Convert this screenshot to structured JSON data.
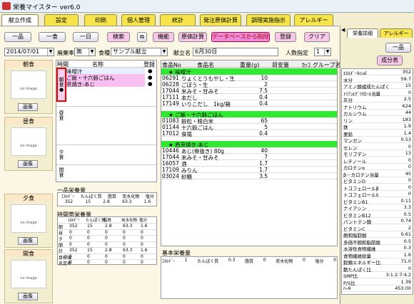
{
  "app": {
    "title": "栄養マイスター ver6.0"
  },
  "tabs": [
    "献立作成",
    "設定",
    "印刷",
    "個人管理",
    "統計",
    "発注原価計算",
    "調理実施指示",
    "アレルギー"
  ],
  "toolbar": {
    "b1": "一品",
    "b2": "一食",
    "b3": "一日",
    "search": "検索",
    "func": "機能",
    "cost": "原価計算",
    "delete_db": "データベースから削除",
    "register": "登録",
    "clear": "クリア"
  },
  "filters": {
    "date": "2014/07/01",
    "waste_label": "廃棄率",
    "waste_val": "無",
    "meal_type_label": "食種",
    "meal_type_val": "サンプル献立",
    "menu_name_label": "献立名",
    "menu_name_val": "6月30日",
    "people_label": "人数指定",
    "people_val": "1"
  },
  "meals": {
    "breakfast": "朝食",
    "lunch": "昼食",
    "dinner": "夕食",
    "snack": "間食",
    "noimage": "no image",
    "image_btn": "画像"
  },
  "menu_list": {
    "col_time": "時間",
    "col_name": "名称",
    "col_reg": "登録",
    "rows": [
      "味噌汁",
      "ご飯・十六穀ごはん",
      "京焼き:あじ"
    ],
    "mark": "●",
    "side": {
      "breakfast": "朝食",
      "lunch": "昼食",
      "dinner": "夕食",
      "snack": "間食"
    }
  },
  "single_nutr": {
    "title": "一品栄養量",
    "headers": [
      "ｴﾈﾙｷﾞｰ",
      "たんぱく質",
      "脂質",
      "炭水化物",
      "塩分"
    ],
    "values": [
      "352",
      "15",
      "2.8",
      "63.3",
      "1.6"
    ]
  },
  "time_nutr": {
    "title": "時間帯栄養量",
    "headers": [
      "",
      "ｴﾈﾙｷﾞｰ",
      "たんぱく質",
      "脂質",
      "炭水化物",
      "塩分"
    ],
    "rows": [
      [
        "朝",
        "352",
        "15",
        "2.8",
        "63.3",
        "1.6"
      ],
      [
        "昼",
        "0",
        "0",
        "0",
        "0",
        "0"
      ],
      [
        "夕",
        "0",
        "0",
        "0",
        "0",
        "0"
      ],
      [
        "間",
        "0",
        "0",
        "0",
        "0",
        "0"
      ],
      [
        "計",
        "352",
        "15",
        "2.8",
        "63.3",
        "1.6"
      ],
      [
        "目標値",
        "0",
        "0",
        "0",
        "0",
        "0"
      ],
      [
        "充足率",
        "0",
        "0",
        "0",
        "0",
        "0"
      ]
    ]
  },
  "ingredients": {
    "headers": [
      "食品No",
      "食品名",
      "重量(g)",
      "目安量",
      "ｶｯｺ",
      "グループ名"
    ],
    "groups": [
      {
        "title": "★ 味噌汁",
        "items": [
          [
            "06291",
            "りょくとうもやし・生",
            "10"
          ],
          [
            "06228",
            "ごぼう・生",
            "2"
          ],
          [
            "17044",
            "米みそ・甘みそ",
            "7.5"
          ],
          [
            "17111",
            "本だし",
            "0.4"
          ],
          [
            "17149",
            "いりこだし　1kg/箱",
            "0.4"
          ]
        ]
      },
      {
        "title": "★ ご飯・十六穀ごはん",
        "items": [
          [
            "01083",
            "穀粒・精白米",
            "65"
          ],
          [
            "01144",
            "十六穀ごはん",
            "5"
          ],
          [
            "17012",
            "食塩",
            "0.4"
          ]
        ]
      },
      {
        "title": "★ 西京焼き:あじ",
        "items": [
          [
            "10446",
            "あじ(骨抜き) 80g",
            "40"
          ],
          [
            "17044",
            "米みそ・甘みそ",
            "7"
          ],
          [
            "16057",
            "酒",
            "1.7"
          ],
          [
            "17109",
            "みりん",
            "1.7"
          ],
          [
            "03024",
            "砂糖",
            "3.5"
          ]
        ]
      }
    ]
  },
  "basic_nutr": {
    "title": "基本栄養量",
    "labels": [
      "ｴﾈﾙｷﾞｰ",
      "1",
      "たんぱく質",
      "0.3",
      "脂質",
      "0",
      "炭水化物",
      "0",
      "塩分",
      "0"
    ]
  },
  "right": {
    "tab1": "栄養詳細",
    "tab2": "アレルギー",
    "b1": "一品",
    "b2": "成分表",
    "col_unit": "ｴﾈﾙｷﾞｰkcal",
    "nutrients": [
      [
        "ｴﾈﾙｷﾞｰkcal",
        "352"
      ],
      [
        "水分",
        "59.7"
      ],
      [
        "アミノ酸組成たんぱく",
        "15"
      ],
      [
        "ﾄﾘｱｼﾙｸﾞﾘｾﾛｰﾙ当量",
        "0"
      ],
      [
        "灰分",
        "2.5"
      ],
      [
        "ナトリウム",
        "624"
      ],
      [
        "カルシウム",
        "44"
      ],
      [
        "リン",
        "183"
      ],
      [
        "鉄",
        "1.9"
      ],
      [
        "亜鉛",
        "1.4"
      ],
      [
        "マンガン",
        "0.53"
      ],
      [
        "セレン",
        "0"
      ],
      [
        "モリブデン",
        "13"
      ],
      [
        "レチノール",
        "0"
      ],
      [
        "カロテンα",
        "0"
      ],
      [
        "β－カロテン当量",
        "45"
      ],
      [
        "ビタミンD",
        "0"
      ],
      [
        "トコフェロールβ",
        "0"
      ],
      [
        "トコフェロールδ",
        "0"
      ],
      [
        "ビタミンB1",
        "0.11"
      ],
      [
        "ナイアシン",
        "3.3"
      ],
      [
        "ビタミンB12",
        "0.5"
      ],
      [
        "パントテン酸",
        "0.74"
      ],
      [
        "ビタミンC",
        "2"
      ],
      [
        "飽和脂肪酸",
        "0.61"
      ],
      [
        "多価不飽和脂肪酸",
        "0.5"
      ],
      [
        "水溶性食物繊維",
        "0.3"
      ],
      [
        "食物繊維総量",
        "1.6"
      ],
      [
        "穀類エネルギー比",
        "71.0"
      ],
      [
        "動たんぱく比",
        "0"
      ],
      [
        "SMP比",
        "3:1.2:7:4.2"
      ],
      [
        "P/S比",
        "1.39"
      ],
      [
        "n-6",
        "453.00"
      ]
    ]
  }
}
